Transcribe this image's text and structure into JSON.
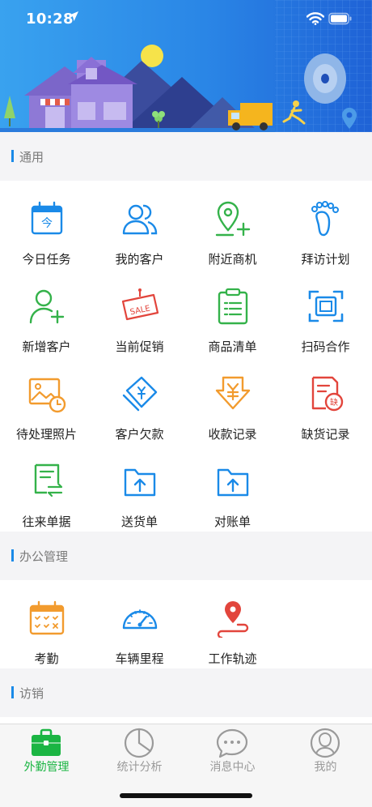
{
  "status_bar": {
    "time": "10:28"
  },
  "sections": [
    {
      "title": "通用",
      "items": [
        {
          "label": "今日任务",
          "icon": "calendar-icon"
        },
        {
          "label": "我的客户",
          "icon": "users-icon"
        },
        {
          "label": "附近商机",
          "icon": "location-add-icon"
        },
        {
          "label": "拜访计划",
          "icon": "footprint-icon"
        },
        {
          "label": "新增客户",
          "icon": "add-user-icon"
        },
        {
          "label": "当前促销",
          "icon": "sale-tag-icon"
        },
        {
          "label": "商品清单",
          "icon": "clipboard-list-icon"
        },
        {
          "label": "扫码合作",
          "icon": "scan-icon"
        },
        {
          "label": "待处理照片",
          "icon": "photo-clock-icon"
        },
        {
          "label": "客户欠款",
          "icon": "money-card-icon"
        },
        {
          "label": "收款记录",
          "icon": "yuan-down-icon"
        },
        {
          "label": "缺货记录",
          "icon": "shortage-icon"
        },
        {
          "label": "往来单据",
          "icon": "exchange-doc-icon"
        },
        {
          "label": "送货单",
          "icon": "folder-upload-icon"
        },
        {
          "label": "对账单",
          "icon": "folder-upload-icon"
        }
      ]
    },
    {
      "title": "办公管理",
      "items": [
        {
          "label": "考勤",
          "icon": "attendance-calendar-icon"
        },
        {
          "label": "车辆里程",
          "icon": "speedometer-icon"
        },
        {
          "label": "工作轨迹",
          "icon": "route-pin-icon"
        }
      ]
    },
    {
      "title": "访销",
      "items": []
    }
  ],
  "tabbar": [
    {
      "label": "外勤管理",
      "icon": "briefcase-icon",
      "active": true
    },
    {
      "label": "统计分析",
      "icon": "pie-chart-icon",
      "active": false
    },
    {
      "label": "消息中心",
      "icon": "chat-bubble-icon",
      "active": false
    },
    {
      "label": "我的",
      "icon": "profile-icon",
      "active": false
    }
  ],
  "colors": {
    "accent": "#1a8ae8",
    "active_tab": "#1bb543",
    "inactive_tab": "#9a9a9a",
    "banner": "#1f6fdc"
  }
}
